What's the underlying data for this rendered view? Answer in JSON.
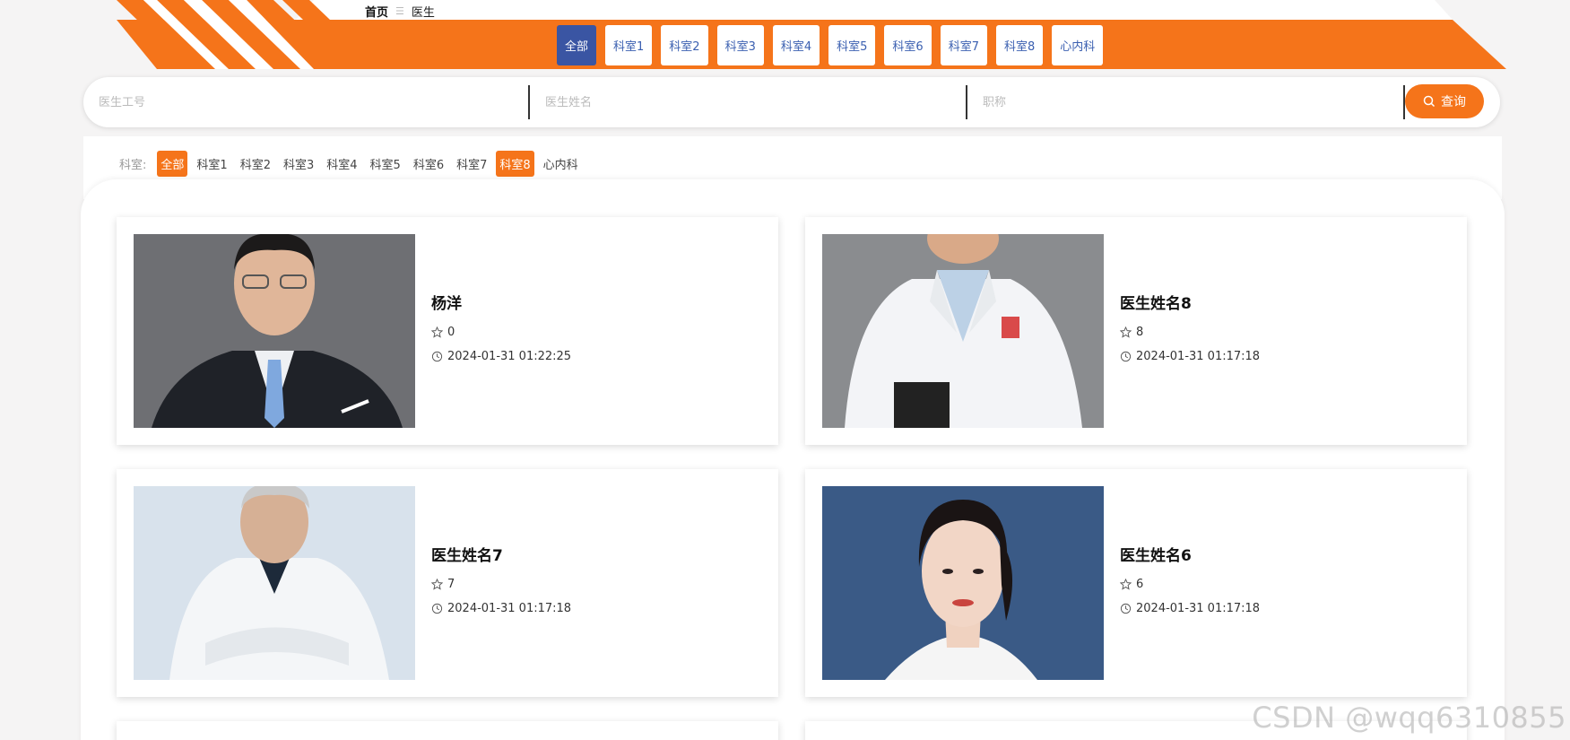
{
  "breadcrumb": {
    "home": "首页",
    "separator": "☰",
    "current": "医生"
  },
  "department_tabs": [
    "全部",
    "科室1",
    "科室2",
    "科室3",
    "科室4",
    "科室5",
    "科室6",
    "科室7",
    "科室8",
    "心内科"
  ],
  "search": {
    "doctor_id_placeholder": "医生工号",
    "doctor_name_placeholder": "医生姓名",
    "title_placeholder": "职称",
    "button_label": "查询"
  },
  "filter": {
    "label": "科室:",
    "items": [
      "全部",
      "科室1",
      "科室2",
      "科室3",
      "科室4",
      "科室5",
      "科室6",
      "科室7",
      "科室8",
      "心内科"
    ]
  },
  "doctors": [
    {
      "name": "杨洋",
      "favorites": "0",
      "time": "2024-01-31 01:22:25"
    },
    {
      "name": "医生姓名8",
      "favorites": "8",
      "time": "2024-01-31 01:17:18"
    },
    {
      "name": "医生姓名7",
      "favorites": "7",
      "time": "2024-01-31 01:17:18"
    },
    {
      "name": "医生姓名6",
      "favorites": "6",
      "time": "2024-01-31 01:17:18"
    }
  ],
  "watermark": "CSDN @wqq6310855",
  "colors": {
    "accent": "#f5741a",
    "active_tab": "#3a55a3",
    "tab_text": "#3a5fb0"
  }
}
